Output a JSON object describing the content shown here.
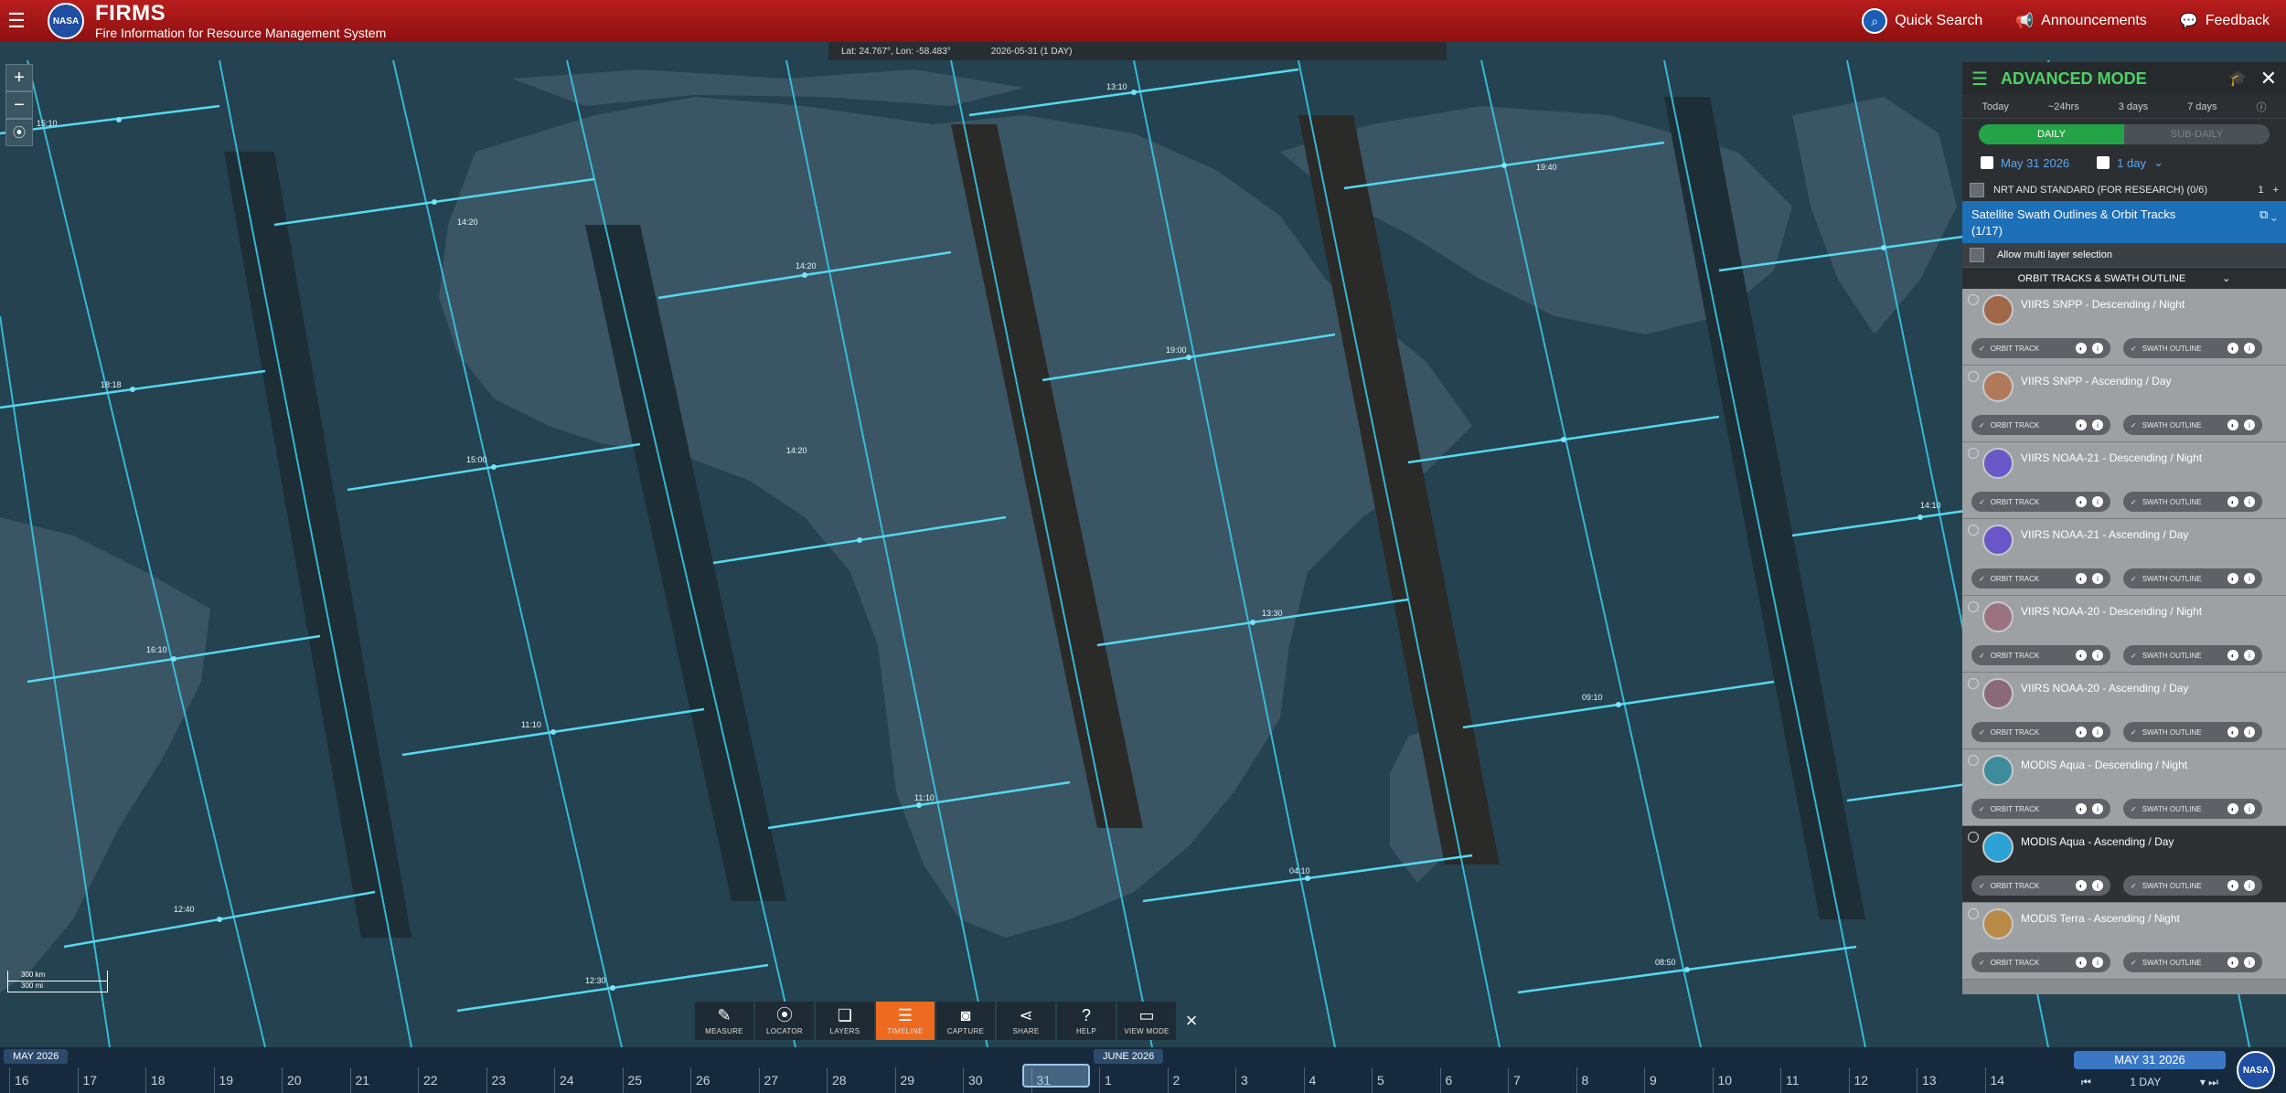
{
  "header": {
    "logo_text": "NASA",
    "title": "FIRMS",
    "subtitle": "Fire Information for Resource Management System",
    "quick_search": "Quick Search",
    "announcements": "Announcements",
    "feedback": "Feedback"
  },
  "coord_bar": {
    "latlon": "Lat: 24.767°, Lon: -58.483°",
    "date": "2026-05-31 (1 DAY)"
  },
  "map": {
    "track_times": [
      "15:10",
      "13:10",
      "14:20",
      "15:00",
      "18:18",
      "14:20",
      "14:20",
      "19:00",
      "19:40",
      "16:10",
      "11:10",
      "11:10",
      "13:30",
      "09:10",
      "12:40",
      "12:30",
      "04:10",
      "08:50",
      "14:10"
    ]
  },
  "scale": {
    "top": "300 km",
    "bottom": "300 mi"
  },
  "toolbar": [
    {
      "icon": "ruler-icon",
      "glyph": "✎",
      "label": "MEASURE"
    },
    {
      "icon": "pin-icon",
      "glyph": "⦿",
      "label": "LOCATOR"
    },
    {
      "icon": "layers-icon",
      "glyph": "❏",
      "label": "LAYERS"
    },
    {
      "icon": "timeline-icon",
      "glyph": "☰",
      "label": "TIMELINE"
    },
    {
      "icon": "camera-icon",
      "glyph": "◙",
      "label": "CAPTURE"
    },
    {
      "icon": "share-icon",
      "glyph": "⋖",
      "label": "SHARE"
    },
    {
      "icon": "help-icon",
      "glyph": "?",
      "label": "HELP"
    },
    {
      "icon": "monitor-icon",
      "glyph": "▭",
      "label": "VIEW MODE"
    }
  ],
  "timeline": {
    "month_left": "MAY 2026",
    "month_right": "JUNE 2026",
    "days": [
      "16",
      "17",
      "18",
      "19",
      "20",
      "21",
      "22",
      "23",
      "24",
      "25",
      "26",
      "27",
      "28",
      "29",
      "30",
      "31",
      "1",
      "2",
      "3",
      "4",
      "5",
      "6",
      "7",
      "8",
      "9",
      "10",
      "11",
      "12",
      "13",
      "14"
    ],
    "selected_date": "MAY 31 2026",
    "span": "1 DAY"
  },
  "panel": {
    "title": "ADVANCED MODE",
    "ranges": [
      "Today",
      "~24hrs",
      "3 days",
      "7 days"
    ],
    "toggle_on": "DAILY",
    "toggle_off": "SUB-DAILY",
    "date": "May 31 2026",
    "span": "1 day",
    "nrt_label": "NRT AND STANDARD (FOR RESEARCH) (0/6)",
    "nrt_count": "1",
    "group_title": "Satellite Swath Outlines & Orbit Tracks",
    "group_count": "(1/17)",
    "allow_multi": "Allow multi layer selection",
    "section_title": "ORBIT TRACKS & SWATH OUTLINE",
    "opt_track": "ORBIT TRACK",
    "opt_swath": "SWATH OUTLINE",
    "items": [
      {
        "title": "VIIRS SNPP - Descending / Night",
        "color": "#a06848"
      },
      {
        "title": "VIIRS SNPP - Ascending / Day",
        "color": "#b07a5a"
      },
      {
        "title": "VIIRS NOAA-21 - Descending / Night",
        "color": "#6b58c8"
      },
      {
        "title": "VIIRS NOAA-21 - Ascending / Day",
        "color": "#6a56c8"
      },
      {
        "title": "VIIRS NOAA-20 - Descending / Night",
        "color": "#9a7280"
      },
      {
        "title": "VIIRS NOAA-20 - Ascending / Day",
        "color": "#8a6a76"
      },
      {
        "title": "MODIS Aqua - Descending / Night",
        "color": "#3c8c9c"
      },
      {
        "title": "MODIS Aqua - Ascending / Day",
        "color": "#2aa2d4"
      },
      {
        "title": "MODIS Terra - Ascending / Night",
        "color": "#b88a48"
      }
    ]
  }
}
